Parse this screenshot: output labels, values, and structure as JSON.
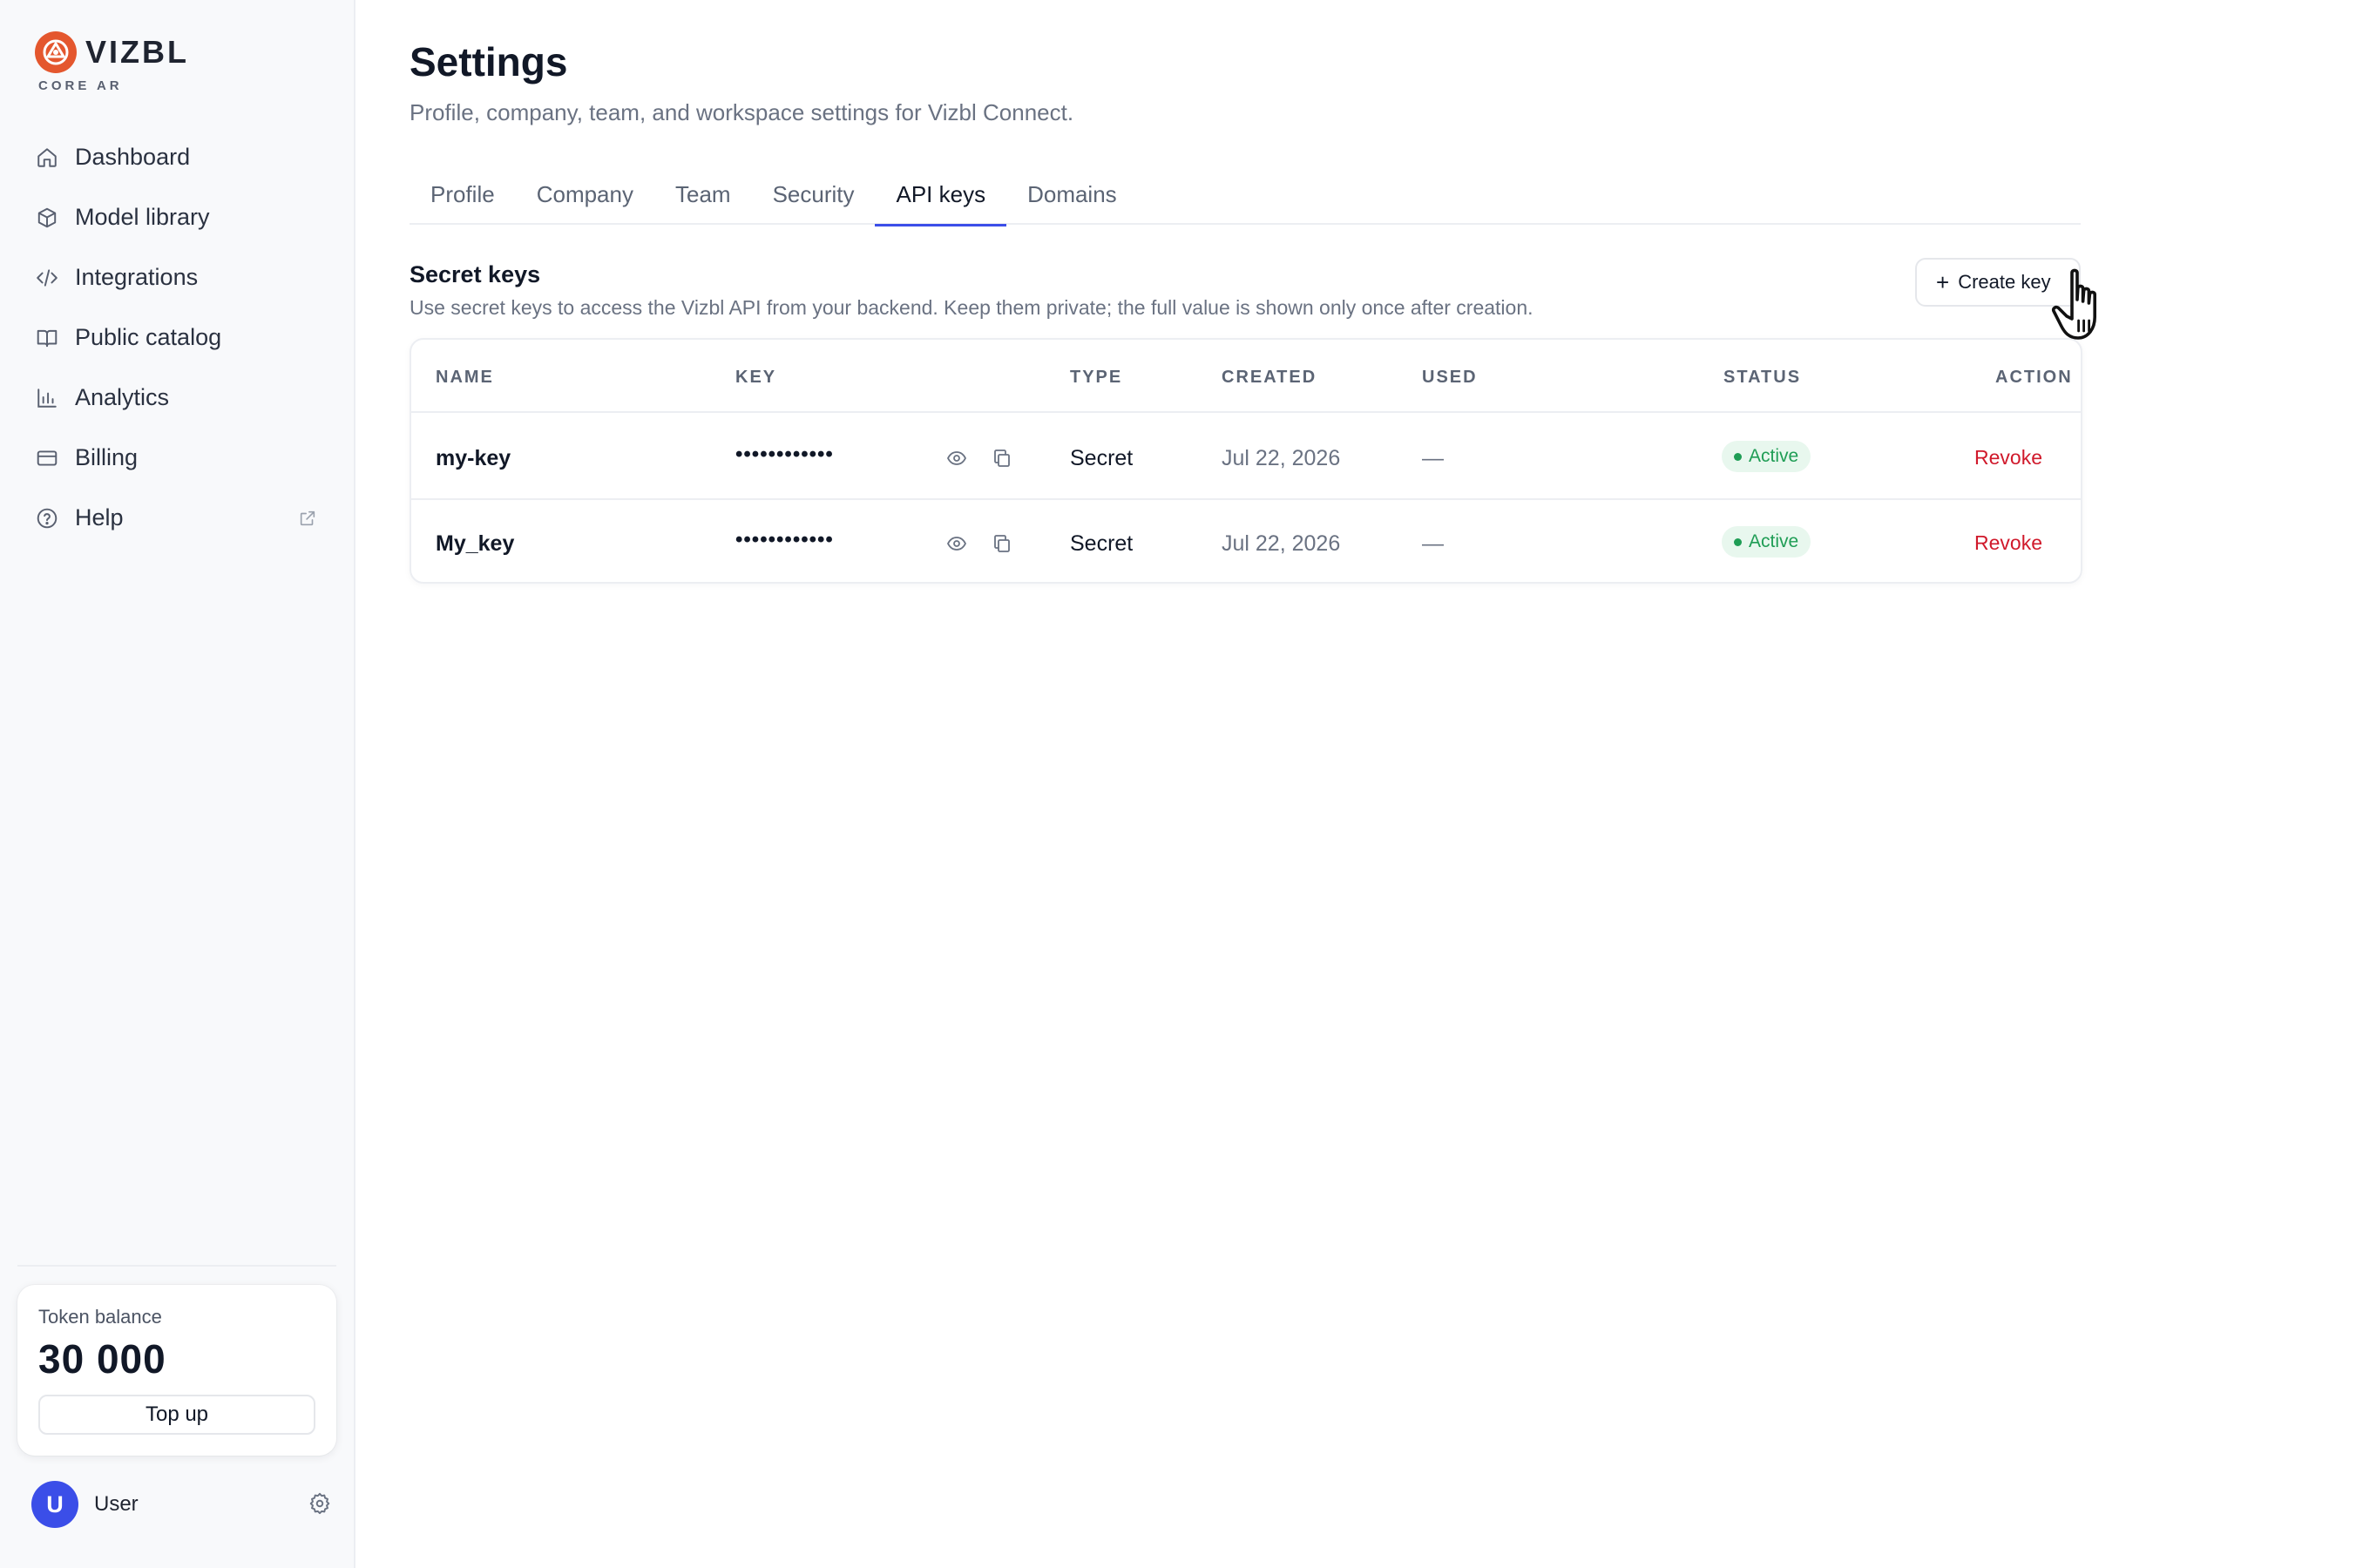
{
  "brand": {
    "name": "VIZBL",
    "sub": "CORE AR",
    "accent": "#e4572e"
  },
  "nav": {
    "items": [
      {
        "label": "Dashboard",
        "icon": "home-icon"
      },
      {
        "label": "Model library",
        "icon": "cube-icon"
      },
      {
        "label": "Integrations",
        "icon": "code-icon"
      },
      {
        "label": "Public catalog",
        "icon": "book-icon"
      },
      {
        "label": "Analytics",
        "icon": "bar-chart-icon"
      },
      {
        "label": "Billing",
        "icon": "credit-card-icon"
      },
      {
        "label": "Help",
        "icon": "help-circle-icon",
        "external": "external-link-icon"
      }
    ]
  },
  "token": {
    "label": "Token balance",
    "value": "30 000",
    "topup_label": "Top up"
  },
  "user": {
    "initial": "U",
    "name": "User",
    "avatar_color": "#3b4ee8"
  },
  "page": {
    "title": "Settings",
    "subtitle": "Profile, company, team, and workspace settings for Vizbl Connect."
  },
  "tabs": [
    {
      "label": "Profile",
      "active": false
    },
    {
      "label": "Company",
      "active": false
    },
    {
      "label": "Team",
      "active": false
    },
    {
      "label": "Security",
      "active": false
    },
    {
      "label": "API keys",
      "active": true
    },
    {
      "label": "Domains",
      "active": false
    }
  ],
  "section": {
    "title": "Secret keys",
    "description": "Use secret keys to access the Vizbl API from your backend. Keep them private; the full value is shown only once after creation.",
    "create_label": "Create key"
  },
  "table": {
    "columns": [
      "NAME",
      "KEY",
      "TYPE",
      "CREATED",
      "USED",
      "STATUS",
      "ACTION"
    ],
    "rows": [
      {
        "name": "my-key",
        "key": "••••••••••••",
        "type": "Secret",
        "created": "Jul 22, 2026",
        "used": "—",
        "status": "Active",
        "action": "Revoke"
      },
      {
        "name": "My_key",
        "key": "••••••••••••",
        "type": "Secret",
        "created": "Jul 22, 2026",
        "used": "—",
        "status": "Active",
        "action": "Revoke"
      }
    ]
  },
  "colors": {
    "tab_indicator": "#3b4ee8",
    "status_active": "#1f9d55",
    "danger": "#d0192b"
  }
}
